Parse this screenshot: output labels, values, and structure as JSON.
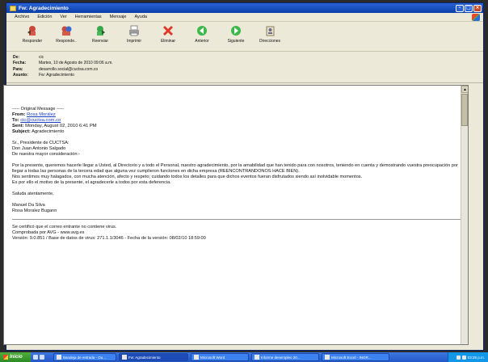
{
  "window": {
    "title": "Fw: Agradecimiento"
  },
  "menu": [
    "Archivo",
    "Edición",
    "Ver",
    "Herramientas",
    "Mensaje",
    "Ayuda"
  ],
  "toolbar": [
    {
      "label": "Responder",
      "icon": "reply-icon"
    },
    {
      "label": "Responde..",
      "icon": "reply-all-icon"
    },
    {
      "label": "Reenviar",
      "icon": "forward-icon"
    },
    {
      "label": "Imprimir",
      "icon": "print-icon"
    },
    {
      "label": "Eliminar",
      "icon": "delete-icon"
    },
    {
      "label": "Anterior",
      "icon": "previous-icon"
    },
    {
      "label": "Siguiente",
      "icon": "next-icon"
    },
    {
      "label": "Direcciones",
      "icon": "address-book-icon"
    }
  ],
  "header": {
    "de_label": "De:",
    "de_value": "cic",
    "fecha_label": "Fecha:",
    "fecha_value": "Martes, 10 de Agosto de 2010 09:06 a.m.",
    "para_label": "Para:",
    "para_value": "desarrollo.social@cuctsa.com.co",
    "asunto_label": "Asunto:",
    "asunto_value": "Fw: Agradecimiento"
  },
  "message": {
    "original": "----- Original Message -----",
    "from_label": "From:",
    "from_value": "Rosa Morález",
    "to_label": "To:",
    "to_value": "cic@cuctsa.com.co",
    "sent_label": "Sent:",
    "sent_value": "Monday, August 02, 2010 6:41 PM",
    "subject_label": "Subject:",
    "subject_value": "Agradecimiento",
    "greeting1": "Sr., Presidente de CUCTSA:",
    "greeting2": "Don Juan Antonio Salgado",
    "greeting3": "De nuestra mayor consideración:-",
    "para1": "Por la presente, queremos hacerle llegar a Usted, al Directorio y a todo el Personal, nuestro agradecimiento, por la amabilidad que han tenido para con nosotros, teniendo en cuenta y demostrando vuestra preocupación por llegar a todas las personas de la tercera edad que alguna vez cumplieron funciones en dicha empresa (REENCONTRANDONOS HACE BIEN).",
    "para2": "Nos sentimos muy halagados, con mucha atención, afecto y respeto; cuidando todos los detalles para que dichos eventos fueran disfrutados siendo así inolvidable momentos.",
    "para3": "Es por ello el motivo de la presente, el agradecerle a todos por esta deferencia.",
    "closing": "Saluda atentamente,",
    "sig1": "Manuel Da Silva",
    "sig2": "Rosa Moralez Bugann",
    "footer1": "Se certificó que el correo entrante no contiene virus.",
    "footer2": "Comprobada por AVG - www.avg.es",
    "footer3": "Versión: 9.0.851 / Base de datos de virus: 271.1.1/3046 - Fecha de la versión: 08/02/10 18:59:00"
  },
  "taskbar": {
    "start": "Inicio",
    "tasks": [
      "Bandeja de entrada - Ou...",
      "Fw: Agradecimiento",
      "Microsoft Word",
      "Informe desempleo 20...",
      "Microsoft Excel - INGR...",
      ""
    ],
    "clock": "03:25 p.m."
  }
}
